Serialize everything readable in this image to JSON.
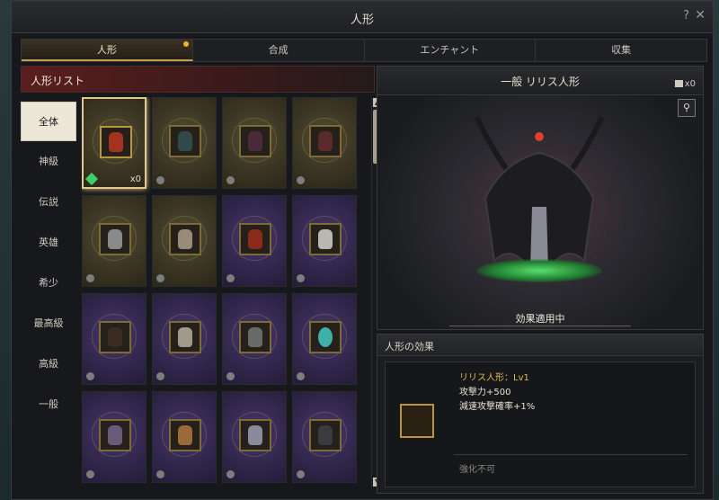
{
  "window": {
    "title": "人形",
    "help": "?",
    "close": "✕"
  },
  "tabs": [
    {
      "label": "人形",
      "active": true,
      "notify": true
    },
    {
      "label": "合成",
      "active": false
    },
    {
      "label": "エンチャント",
      "active": false
    },
    {
      "label": "収集",
      "active": false
    }
  ],
  "list": {
    "header": "人形リスト",
    "categories": [
      "全体",
      "神級",
      "伝説",
      "英雄",
      "希少",
      "最高級",
      "高級",
      "一般"
    ],
    "selected_category": "全体",
    "cards": [
      {
        "tier": "gold",
        "selected": true,
        "owned": true,
        "qty": "x0",
        "icon": "lilith-doll-icon"
      },
      {
        "tier": "gold",
        "icon": "armored-knight-doll-icon"
      },
      {
        "tier": "gold",
        "icon": "dark-horned-doll-icon"
      },
      {
        "tier": "gold",
        "icon": "red-mage-doll-icon"
      },
      {
        "tier": "gold",
        "icon": "white-lion-doll-icon"
      },
      {
        "tier": "gold",
        "icon": "bone-dragon-doll-icon"
      },
      {
        "tier": "purple",
        "icon": "red-demon-doll-icon"
      },
      {
        "tier": "purple",
        "icon": "silver-hair-doll-icon"
      },
      {
        "tier": "purple",
        "icon": "dark-ogre-doll-icon"
      },
      {
        "tier": "purple",
        "icon": "skull-doll-icon"
      },
      {
        "tier": "purple",
        "icon": "horned-beast-doll-icon"
      },
      {
        "tier": "purple",
        "icon": "crystal-orb-doll-icon"
      },
      {
        "tier": "purple",
        "icon": "witch-doll-icon"
      },
      {
        "tier": "purple",
        "icon": "warrior-doll-icon"
      },
      {
        "tier": "purple",
        "icon": "elf-doll-icon"
      },
      {
        "tier": "purple",
        "icon": "golem-doll-icon"
      }
    ]
  },
  "detail": {
    "title": "一般 リリス人形",
    "count": "x0",
    "zoom_icon": "magnifier-icon",
    "status": "効果適用中"
  },
  "effects": {
    "header": "人形の効果",
    "name": "リリス人形：Lv1",
    "lines": [
      "攻撃力+500",
      "減速攻撃確率+1%"
    ],
    "note": "強化不可"
  },
  "colors": {
    "accent_gold": "#e4c98c",
    "effect_title": "#e7b84d",
    "tab_active_border": "#c39a52"
  }
}
